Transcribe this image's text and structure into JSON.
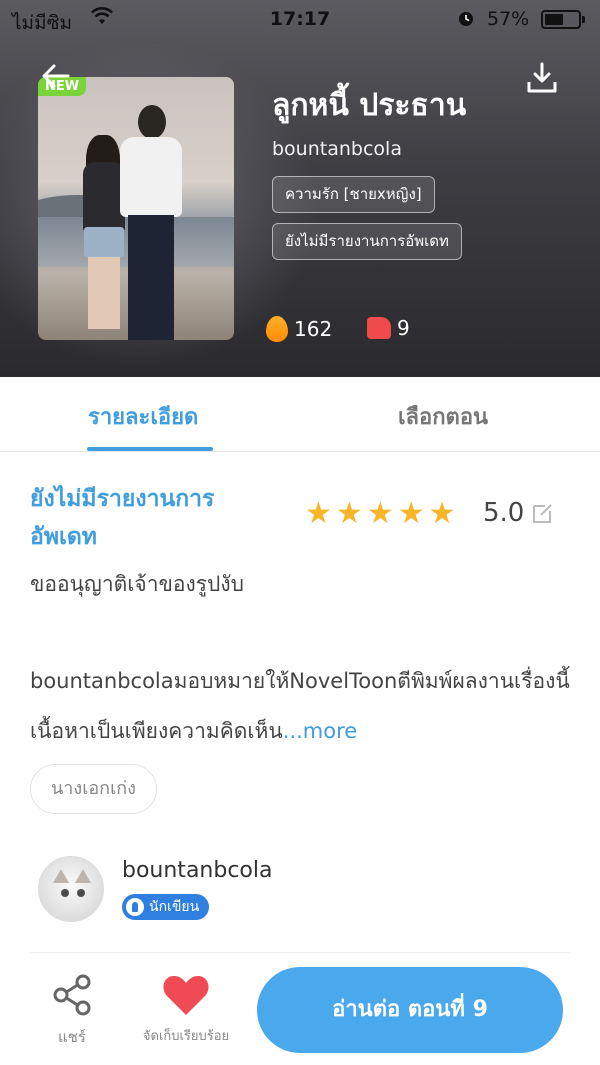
{
  "status_bar": {
    "carrier": "ไม่มีซิม",
    "time": "17:17",
    "battery": "57%",
    "battery_level": 0.57
  },
  "book": {
    "badge": "NEW",
    "title": "ลูกหนี้ ประธาน",
    "author": "bountanbcola",
    "tags": [
      "ความรัก [ชายxหญิง]",
      "ยังไม่มีรายงานการอัพเดท"
    ],
    "popularity": "162",
    "likes": "9"
  },
  "tabs": [
    {
      "label": "รายละเอียด",
      "active": true
    },
    {
      "label": "เลือกตอน",
      "active": false
    }
  ],
  "details": {
    "update_status": "ยังไม่มีรายงานการอัพเดท",
    "rating": "5.0",
    "star_count": 5,
    "description_1": "ขออนุญาติเจ้าของรูปงับ",
    "description_2": "bountanbcolaมอบหมายให้NovelToonตีพิมพ์ผลงานเรื่องนี้ เนื้อหาเป็นเพียงความคิดเห็น",
    "more_label": "...more",
    "genre_tag": "นางเอกเก่ง"
  },
  "author_card": {
    "name": "bountanbcola",
    "badge": "นักเขียน"
  },
  "bottom_bar": {
    "share_label": "แชร์",
    "collect_label": "จัดเก็บเรียบร้อย",
    "continue_label": "อ่านต่อ ตอนที่ 9"
  },
  "colors": {
    "accent": "#3f9de0",
    "star": "#f7b529",
    "heart": "#f04a55",
    "new_badge": "#7bd33a"
  },
  "icons": [
    "back-arrow-icon",
    "download-icon",
    "wifi-icon",
    "alarm-icon",
    "fire-icon",
    "thumbs-up-icon",
    "star-icon",
    "edit-icon",
    "pen-icon",
    "share-icon",
    "heart-icon"
  ]
}
